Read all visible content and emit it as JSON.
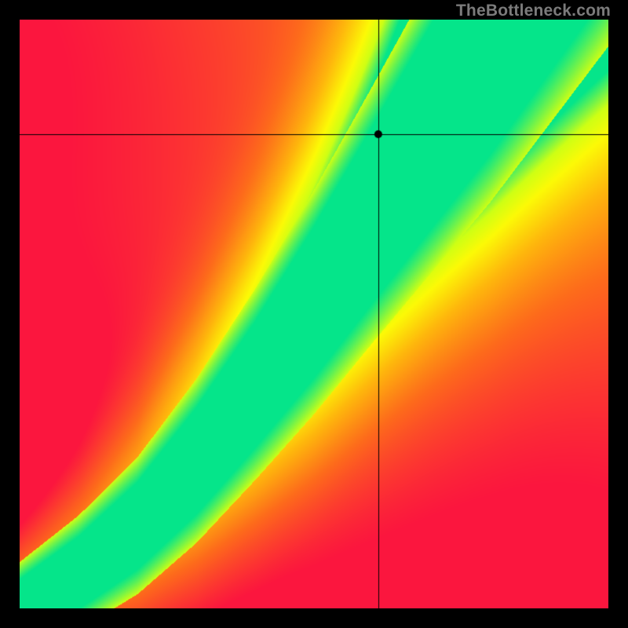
{
  "watermark": "TheBottleneck.com",
  "chart_data": {
    "type": "heatmap",
    "title": "",
    "xlabel": "",
    "ylabel": "",
    "xlim": [
      0,
      1
    ],
    "ylim": [
      0,
      1
    ],
    "crosshair": {
      "x": 0.61,
      "y": 0.805
    },
    "marker": {
      "x": 0.61,
      "y": 0.805
    },
    "ridge_points": [
      {
        "x": 0.0,
        "y": 0.0
      },
      {
        "x": 0.1,
        "y": 0.06
      },
      {
        "x": 0.2,
        "y": 0.14
      },
      {
        "x": 0.3,
        "y": 0.25
      },
      {
        "x": 0.4,
        "y": 0.38
      },
      {
        "x": 0.5,
        "y": 0.52
      },
      {
        "x": 0.6,
        "y": 0.67
      },
      {
        "x": 0.7,
        "y": 0.82
      },
      {
        "x": 0.8,
        "y": 0.97
      },
      {
        "x": 0.85,
        "y": 1.05
      }
    ],
    "ridge_width": [
      {
        "x": 0.0,
        "w": 0.008
      },
      {
        "x": 0.2,
        "w": 0.015
      },
      {
        "x": 0.4,
        "w": 0.03
      },
      {
        "x": 0.6,
        "w": 0.055
      },
      {
        "x": 0.8,
        "w": 0.085
      },
      {
        "x": 1.0,
        "w": 0.11
      }
    ],
    "color_stops": [
      {
        "t": 0.0,
        "color": "#fb163e"
      },
      {
        "t": 0.35,
        "color": "#fd6b1b"
      },
      {
        "t": 0.6,
        "color": "#feb70c"
      },
      {
        "t": 0.78,
        "color": "#fcfa06"
      },
      {
        "t": 0.88,
        "color": "#ceff14"
      },
      {
        "t": 1.0,
        "color": "#05e58a"
      }
    ],
    "background_map": "radial two-corner gradient: top-left red, bottom-right red, along diagonal ridge green, transitioning through orange→yellow",
    "grid": false,
    "legend": null
  }
}
